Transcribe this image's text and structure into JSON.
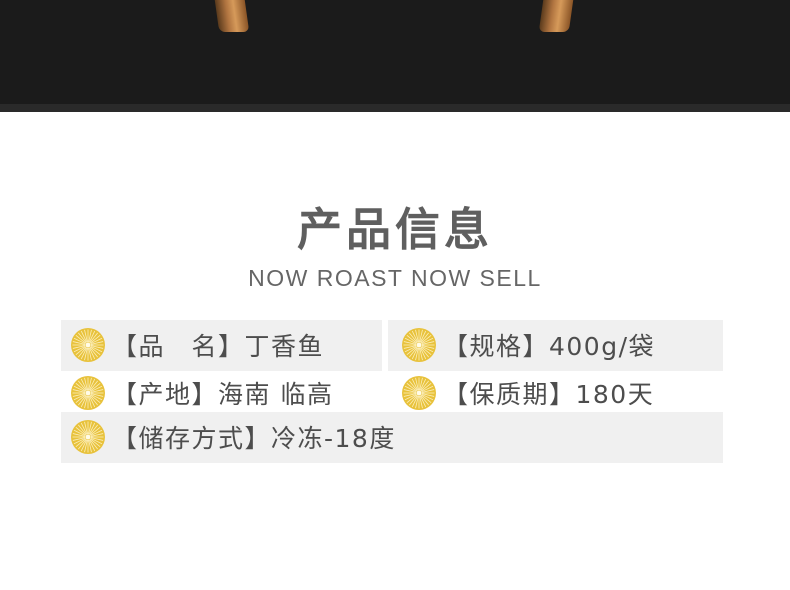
{
  "section": {
    "title": "产品信息",
    "subtitle": "NOW ROAST NOW SELL"
  },
  "info": {
    "name": "【品　名】丁香鱼",
    "spec": "【规格】400g/袋",
    "origin": "【产地】海南 临高",
    "shelf_life": "【保质期】180天",
    "storage": "【储存方式】冷冻-18度"
  },
  "colors": {
    "row_bg": "#f0f0f0",
    "icon_gold": "#e8c23c",
    "top_band": "#1b1b1b",
    "text": "#4d4d4d"
  },
  "icons": [
    "sunburst-icon"
  ]
}
